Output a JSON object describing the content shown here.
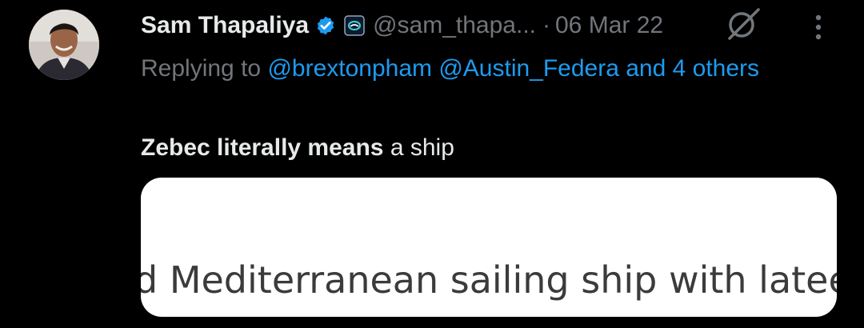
{
  "tweet": {
    "author": {
      "display_name": "Sam Thapaliya",
      "handle": "@sam_thapa...",
      "verified_icon": "verified-badge-icon",
      "affiliate_icon": "affiliate-badge-icon",
      "avatar": "user-avatar"
    },
    "separator": "·",
    "date": "06 Mar 22",
    "replying_prefix": "Replying to ",
    "replying_mentions": "@brextonpham @Austin_Federa and 4 others",
    "text_bold": "Zebec literally means",
    "text_rest": " a ship",
    "media_text": "d Mediterranean sailing ship with lateen",
    "actions": {
      "grok_icon": "grok-icon",
      "more_icon": "more-vertical-icon"
    }
  },
  "colors": {
    "background": "#000000",
    "primary_text": "#e7e9ea",
    "secondary_text": "#71767b",
    "link": "#1d9bf0",
    "verified": "#1d9bf0"
  }
}
